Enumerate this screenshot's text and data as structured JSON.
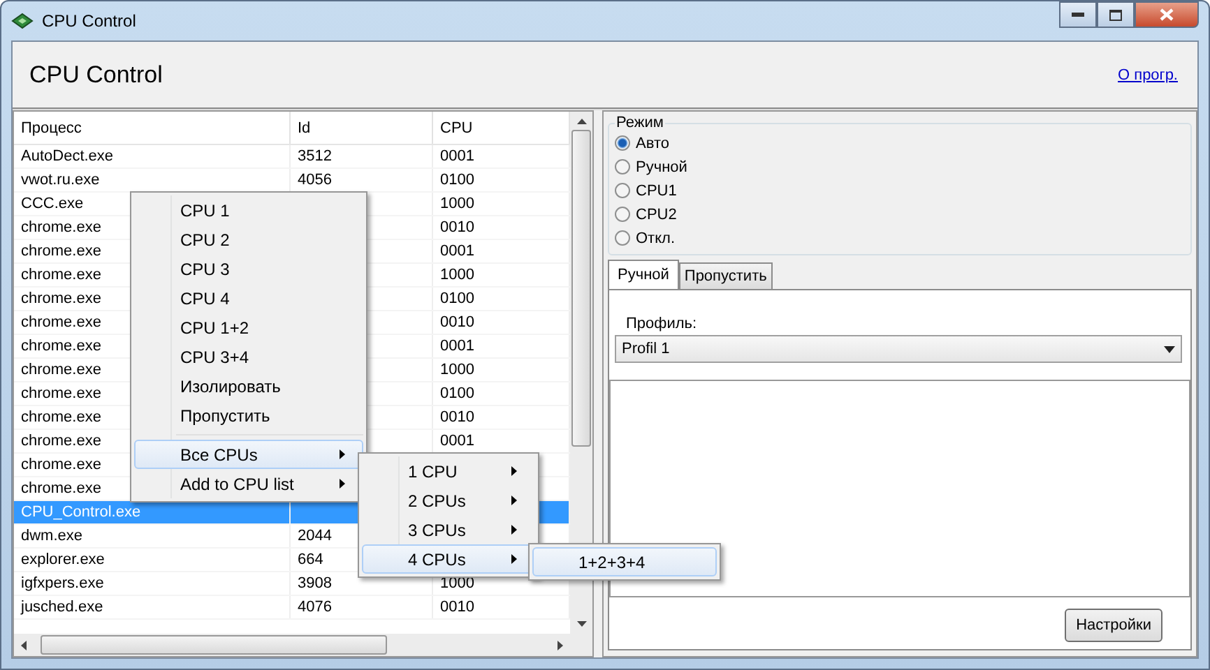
{
  "window": {
    "title": "CPU Control"
  },
  "header": {
    "title": "CPU Control",
    "link": "О прогр."
  },
  "table": {
    "columns": [
      "Процесс",
      "Id",
      "CPU"
    ],
    "rows": [
      {
        "name": "AutoDect.exe",
        "id": "3512",
        "cpu": "0001",
        "selected": false
      },
      {
        "name": "vwot.ru.exe",
        "id": "4056",
        "cpu": "0100",
        "selected": false
      },
      {
        "name": "CCC.exe",
        "cpu": "1000",
        "selected": false
      },
      {
        "name": "chrome.exe",
        "cpu": "0010",
        "selected": false
      },
      {
        "name": "chrome.exe",
        "cpu": "0001",
        "selected": false
      },
      {
        "name": "chrome.exe",
        "cpu": "1000",
        "selected": false
      },
      {
        "name": "chrome.exe",
        "cpu": "0100",
        "selected": false
      },
      {
        "name": "chrome.exe",
        "cpu": "0010",
        "selected": false
      },
      {
        "name": "chrome.exe",
        "cpu": "0001",
        "selected": false
      },
      {
        "name": "chrome.exe",
        "cpu": "1000",
        "selected": false
      },
      {
        "name": "chrome.exe",
        "cpu": "0100",
        "selected": false
      },
      {
        "name": "chrome.exe",
        "cpu": "0010",
        "selected": false
      },
      {
        "name": "chrome.exe",
        "cpu": "0001",
        "selected": false
      },
      {
        "name": "chrome.exe",
        "selected": false
      },
      {
        "name": "chrome.exe",
        "selected": false
      },
      {
        "name": "CPU_Control.exe",
        "selected": true
      },
      {
        "name": "dwm.exe",
        "id": "2044",
        "selected": false
      },
      {
        "name": "explorer.exe",
        "id": "664",
        "selected": false
      },
      {
        "name": "igfxpers.exe",
        "id": "3908",
        "cpu": "1000",
        "selected": false
      },
      {
        "name": "jusched.exe",
        "id": "4076",
        "cpu": "0010",
        "selected": false
      }
    ]
  },
  "mode": {
    "title": "Режим",
    "options": [
      {
        "label": "Авто",
        "selected": true
      },
      {
        "label": "Ручной",
        "selected": false
      },
      {
        "label": "CPU1",
        "selected": false
      },
      {
        "label": "CPU2",
        "selected": false
      },
      {
        "label": "Откл.",
        "selected": false
      }
    ]
  },
  "tabs": [
    {
      "label": "Ручной",
      "selected": true
    },
    {
      "label": "Пропустить",
      "selected": false
    }
  ],
  "profile": {
    "label": "Профиль:",
    "value": "Profil 1"
  },
  "settings_button": "Настройки",
  "context_menu": [
    {
      "kind": "command",
      "label": "CPU 1",
      "selected": false
    },
    {
      "kind": "command",
      "label": "CPU 2",
      "selected": false
    },
    {
      "kind": "command",
      "label": "CPU 3",
      "selected": false
    },
    {
      "kind": "command",
      "label": "CPU 4",
      "selected": false
    },
    {
      "kind": "command",
      "label": "CPU 1+2",
      "selected": false
    },
    {
      "kind": "command",
      "label": "CPU 3+4",
      "selected": false
    },
    {
      "kind": "command",
      "label": "Изолировать",
      "selected": false
    },
    {
      "kind": "command",
      "label": "Пропустить",
      "selected": false
    },
    {
      "kind": "separator"
    },
    {
      "kind": "submenu",
      "label": "Все CPUs",
      "selected": true
    },
    {
      "kind": "submenu",
      "label": "Add to CPU list",
      "selected": false
    }
  ],
  "submenu": [
    {
      "kind": "submenu",
      "label": "1 CPU",
      "selected": false
    },
    {
      "kind": "submenu",
      "label": "2 CPUs",
      "selected": false
    },
    {
      "kind": "submenu",
      "label": "3 CPUs",
      "selected": false
    },
    {
      "kind": "submenu",
      "label": "4 CPUs",
      "selected": true
    }
  ],
  "submenu_2": [
    {
      "kind": "command",
      "label": "1+2+3+4",
      "selected": true
    }
  ]
}
